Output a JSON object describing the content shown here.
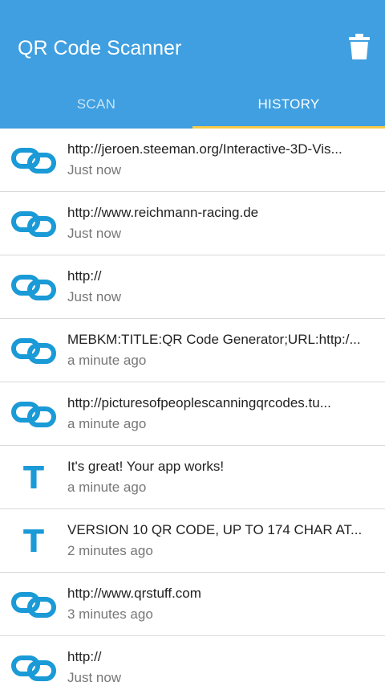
{
  "app": {
    "title": "QR Code Scanner"
  },
  "colors": {
    "appbar": "#3f9fe0",
    "tab_indicator": "#f5c94a",
    "icon": "#1a9ad6"
  },
  "tabs": [
    {
      "label": "SCAN",
      "active": false
    },
    {
      "label": "HISTORY",
      "active": true
    }
  ],
  "history": [
    {
      "type": "link-icon",
      "text": "http://jeroen.steeman.org/Interactive-3D-Vis...",
      "time": "Just now"
    },
    {
      "type": "link-icon",
      "text": "http://www.reichmann-racing.de",
      "time": "Just now"
    },
    {
      "type": "link-icon",
      "text": "http://",
      "time": "Just now"
    },
    {
      "type": "link-icon",
      "text": "MEBKM:TITLE:QR Code Generator;URL:http:/...",
      "time": "a minute ago"
    },
    {
      "type": "link-icon",
      "text": "http://picturesofpeoplescanningqrcodes.tu...",
      "time": "a minute ago"
    },
    {
      "type": "text-icon",
      "glyph": "T",
      "text": "It's great! Your app works!",
      "time": "a minute ago"
    },
    {
      "type": "text-icon",
      "glyph": "T",
      "text": "VERSION 10 QR CODE, UP TO 174 CHAR AT...",
      "time": "2 minutes ago"
    },
    {
      "type": "link-icon",
      "text": "http://www.qrstuff.com",
      "time": "3 minutes ago"
    },
    {
      "type": "link-icon",
      "text": "http://",
      "time": "Just now"
    }
  ]
}
